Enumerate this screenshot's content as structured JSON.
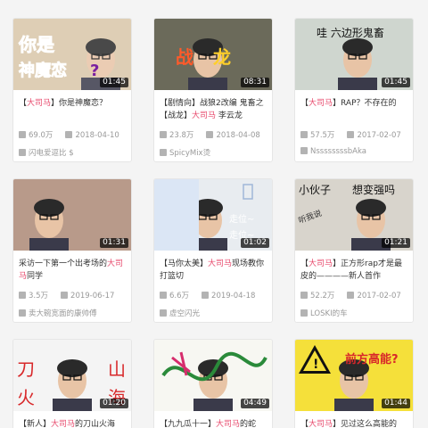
{
  "colors": {
    "highlight": "#e84b6e",
    "meta": "#999999",
    "title": "#333333"
  },
  "cards": [
    {
      "title_pre": "【",
      "title_hl": "大司马",
      "title_post": "】你是神魔恋？",
      "views": "69.0万",
      "date": "2018-04-10",
      "author": "闪电爱逗比 $",
      "duration": "01:45",
      "overlay": "你是 神魔恋？"
    },
    {
      "title_pre": "【剧情向】战狼2改编 鬼畜之【战龙】",
      "title_hl": "大司马",
      "title_post": " 李云龙",
      "views": "23.8万",
      "date": "2018-04-08",
      "author": "SpicyMix烫",
      "duration": "08:31",
      "overlay": "战 龙"
    },
    {
      "title_pre": "【",
      "title_hl": "大司马",
      "title_post": "】RAP？不存在的",
      "views": "57.5万",
      "date": "2017-02-07",
      "author": "NssssssssbAka",
      "duration": "01:45",
      "overlay": "哇 六边形鬼畜"
    },
    {
      "title_pre": "采访一下第一个出考场的",
      "title_hl": "大司马",
      "title_post": "同学",
      "views": "3.5万",
      "date": "2019-06-17",
      "author": "卖大碗宽面的康帅傅",
      "duration": "01:31",
      "overlay": ""
    },
    {
      "title_pre": "【马你太美】",
      "title_hl": "大司马",
      "title_post": "现场教你打篮切",
      "views": "6.6万",
      "date": "2019-04-18",
      "author": "虚空闪光",
      "duration": "01:02",
      "overlay": "走位~ 走位~"
    },
    {
      "title_pre": "【",
      "title_hl": "大司马",
      "title_post": "】正方形rap才是最皮的————新人首作",
      "views": "52.2万",
      "date": "2017-02-07",
      "author": "LOSKI的车",
      "duration": "01:21",
      "overlay": "小伙子 想变强吗"
    },
    {
      "title_pre": "【新人】",
      "title_hl": "大司马",
      "title_post": "的刀山火海",
      "views": "",
      "date": "",
      "author": "",
      "duration": "01:20",
      "overlay": "刀 火 山 海"
    },
    {
      "title_pre": "【九九瓜十一】",
      "title_hl": "大司马",
      "title_post": "的蛇",
      "views": "",
      "date": "",
      "author": "",
      "duration": "04:49",
      "overlay": ""
    },
    {
      "title_pre": "【",
      "title_hl": "大司马",
      "title_post": "】见过这么高能的",
      "views": "",
      "date": "",
      "author": "",
      "duration": "01:44",
      "overlay": "前方高能？"
    }
  ]
}
